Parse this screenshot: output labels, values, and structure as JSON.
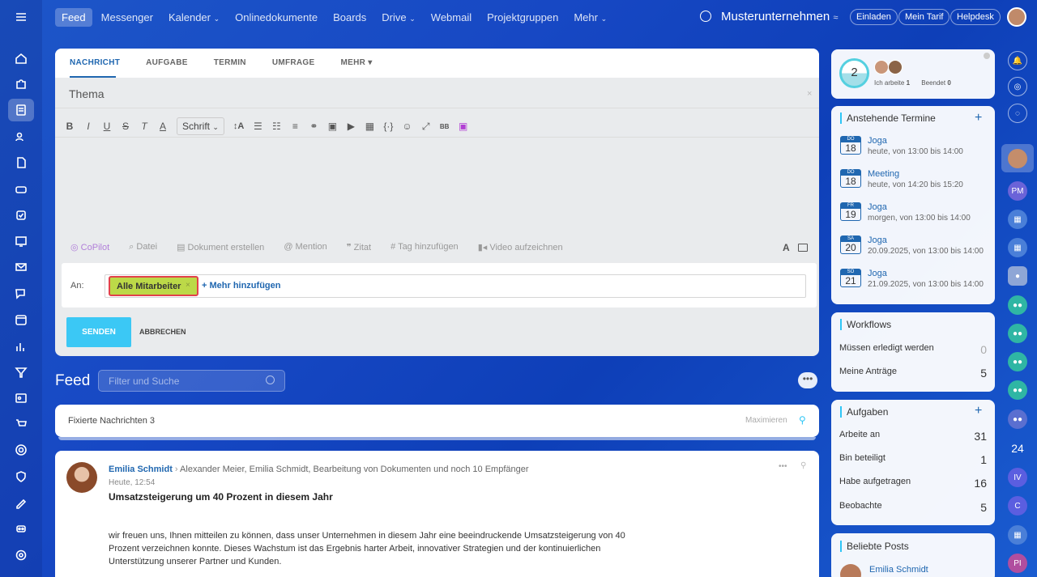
{
  "nav": {
    "items": [
      "Feed",
      "Messenger",
      "Kalender",
      "Onlinedokumente",
      "Boards",
      "Drive",
      "Webmail",
      "Projektgruppen",
      "Mehr"
    ],
    "company": "Musterunternehmen",
    "invite": "Einladen",
    "plan": "Mein Tarif",
    "help": "Helpdesk"
  },
  "composer": {
    "tabs": [
      "NACHRICHT",
      "AUFGABE",
      "TERMIN",
      "UMFRAGE",
      "MEHR"
    ],
    "subject_placeholder": "Thema",
    "font_label": "Schrift",
    "actions": [
      "CoPilot",
      "Datei",
      "Dokument erstellen",
      "Mention",
      "Zitat",
      "Tag hinzufügen",
      "Video aufzeichnen"
    ],
    "to_label": "An:",
    "recipient": "Alle Mitarbeiter",
    "add_more": "+ Mehr hinzufügen",
    "send": "SENDEN",
    "cancel": "ABBRECHEN"
  },
  "feed": {
    "title": "Feed",
    "search_placeholder": "Filter und Suche",
    "pinned_label": "Fixierte Nachrichten",
    "pinned_count": "3",
    "maximize": "Maximieren"
  },
  "post": {
    "author": "Emilia Schmidt",
    "recipients": "Alexander Meier, Emilia Schmidt, Bearbeitung von Dokumenten  und noch 10 Empfänger",
    "time": "Heute, 12:54",
    "title": "Umsatzsteigerung um 40 Prozent in diesem Jahr",
    "body": "wir freuen uns, Ihnen mitteilen zu können, dass unser Unternehmen in diesem Jahr eine beeindruckende Umsatzsteigerung von 40 Prozent verzeichnen konnte. Dieses Wachstum ist das Ergebnis harter Arbeit, innovativer Strategien und der kontinuierlichen Unterstützung unserer Partner und Kunden."
  },
  "status": {
    "count": "2",
    "working_label": "Ich arbeite",
    "working": "1",
    "finished_label": "Beendet",
    "finished": "0"
  },
  "events": {
    "title": "Anstehende Termine",
    "items": [
      {
        "dow": "DO",
        "day": "18",
        "name": "Joga",
        "when": "heute, von 13:00 bis 14:00"
      },
      {
        "dow": "DO",
        "day": "18",
        "name": "Meeting",
        "when": "heute, von 14:20 bis 15:20"
      },
      {
        "dow": "FR",
        "day": "19",
        "name": "Joga",
        "when": "morgen, von 13:00 bis 14:00"
      },
      {
        "dow": "SA",
        "day": "20",
        "name": "Joga",
        "when": "20.09.2025, von 13:00 bis 14:00"
      },
      {
        "dow": "SO",
        "day": "21",
        "name": "Joga",
        "when": "21.09.2025, von 13:00 bis 14:00"
      }
    ]
  },
  "workflows": {
    "title": "Workflows",
    "rows": [
      {
        "label": "Müssen erledigt werden",
        "value": "0"
      },
      {
        "label": "Meine Anträge",
        "value": "5"
      }
    ]
  },
  "tasks": {
    "title": "Aufgaben",
    "rows": [
      {
        "label": "Arbeite an",
        "value": "31"
      },
      {
        "label": "Bin beteiligt",
        "value": "1"
      },
      {
        "label": "Habe aufgetragen",
        "value": "16"
      },
      {
        "label": "Beobachte",
        "value": "5"
      }
    ]
  },
  "popular": {
    "title": "Beliebte Posts",
    "author": "Emilia Schmidt"
  },
  "rightbar": {
    "initials": [
      "PM",
      "24",
      "IV",
      "C",
      "PI"
    ]
  }
}
